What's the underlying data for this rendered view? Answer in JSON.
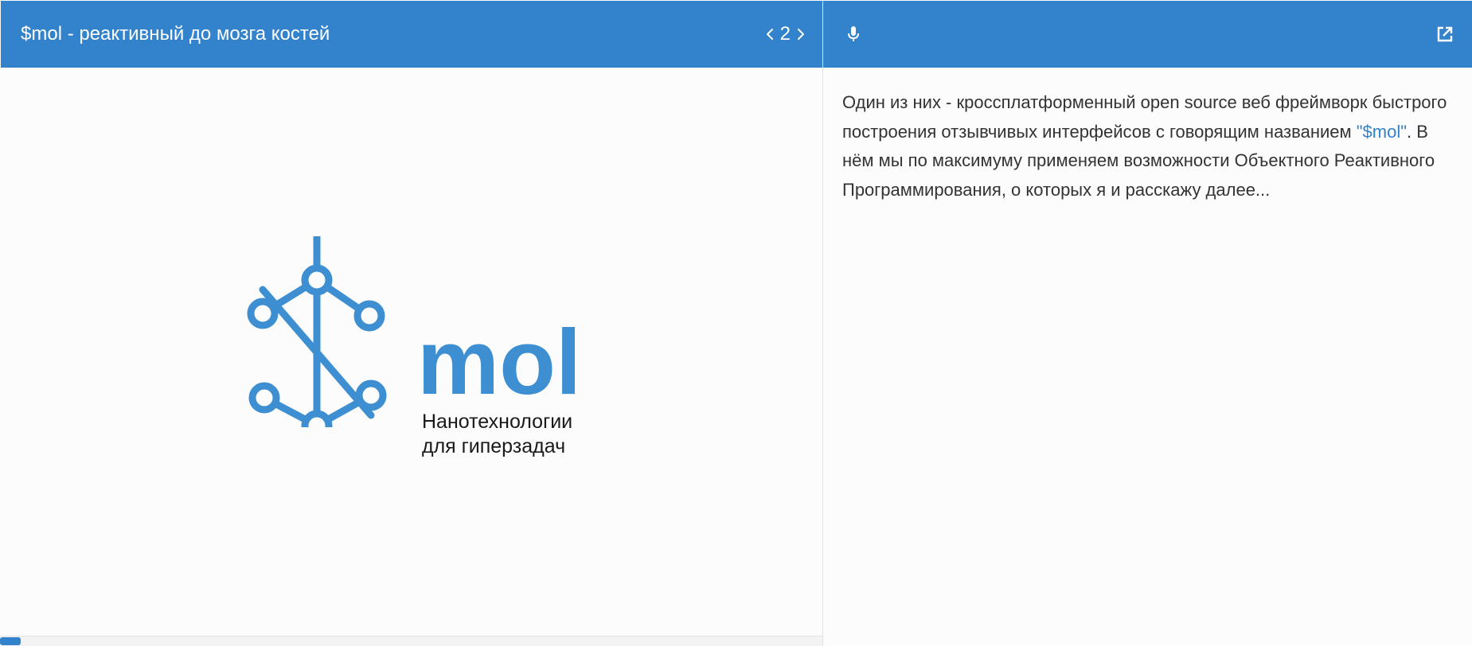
{
  "slide": {
    "title": "$mol - реактивный до мозга костей",
    "nav": {
      "prev_glyph": "‹",
      "page": "2",
      "next_glyph": "›"
    },
    "logo": {
      "wordmark": "mol",
      "tagline_line1": "Нанотехнологии",
      "tagline_line2": "для гиперзадач",
      "color": "#3d8fd1"
    },
    "progress": 0.025
  },
  "notes": {
    "text_before_link": "Один из них - кроссплатформенный open source веб фреймворк быстрого построения отзывчивых интерфейсов с говорящим названием ",
    "link_text": "\"$mol\"",
    "text_after_link": ". В нём мы по максимуму применяем возможности Объектного Реактивного Программирования, о которых я и расскажу далее..."
  },
  "icons": {
    "microphone": "microphone-icon",
    "open_external": "open-external-icon",
    "prev": "chevron-left-icon",
    "next": "chevron-right-icon"
  },
  "colors": {
    "header": "#3382cc",
    "accent": "#3d8fd1",
    "background": "#fcfcfc",
    "text": "#333333"
  }
}
